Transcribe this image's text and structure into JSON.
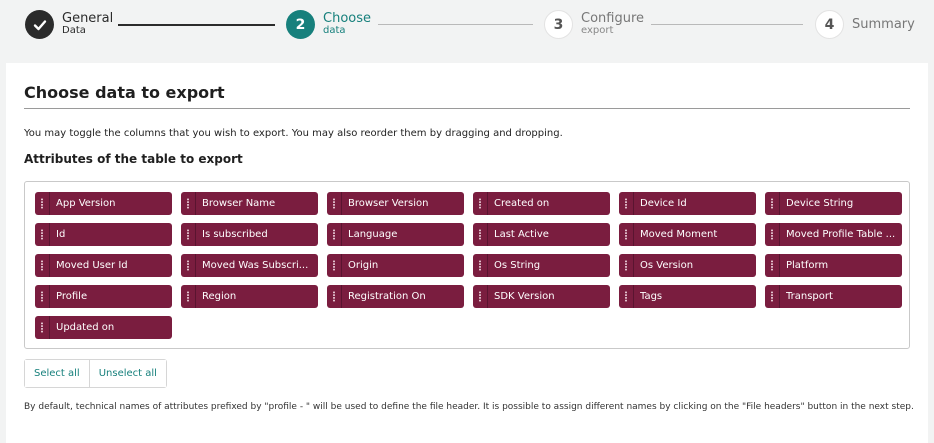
{
  "stepper": {
    "steps": [
      {
        "number": "",
        "title": "General",
        "subtitle": "Data",
        "state": "done",
        "icon": "check-icon"
      },
      {
        "number": "2",
        "title": "Choose",
        "subtitle": "data",
        "state": "active"
      },
      {
        "number": "3",
        "title": "Configure",
        "subtitle": "export",
        "state": "todo"
      },
      {
        "number": "4",
        "title": "Summary",
        "subtitle": "",
        "state": "todo"
      }
    ]
  },
  "card": {
    "title": "Choose data to export",
    "description": "You may toggle the columns that you wish to export. You may also reorder them by dragging and dropping.",
    "attributes_title": "Attributes of the table to export",
    "attributes": [
      "App Version",
      "Browser Name",
      "Browser Version",
      "Created on",
      "Device Id",
      "Device String",
      "Id",
      "Is subscribed",
      "Language",
      "Last Active",
      "Moved Moment",
      "Moved Profile Table ...",
      "Moved User Id",
      "Moved Was Subscri...",
      "Origin",
      "Os String",
      "Os Version",
      "Platform",
      "Profile",
      "Region",
      "Registration On",
      "SDK Version",
      "Tags",
      "Transport",
      "Updated on"
    ],
    "select_all": "Select all",
    "unselect_all": "Unselect all",
    "footnote": "By default, technical names of attributes prefixed by \"profile - \" will be used to define the file header. It is possible to assign different names by clicking on the \"File headers\" button in the next step."
  },
  "colors": {
    "accent": "#17807c",
    "chip": "#7a1d3f",
    "done": "#2b2b2b"
  }
}
